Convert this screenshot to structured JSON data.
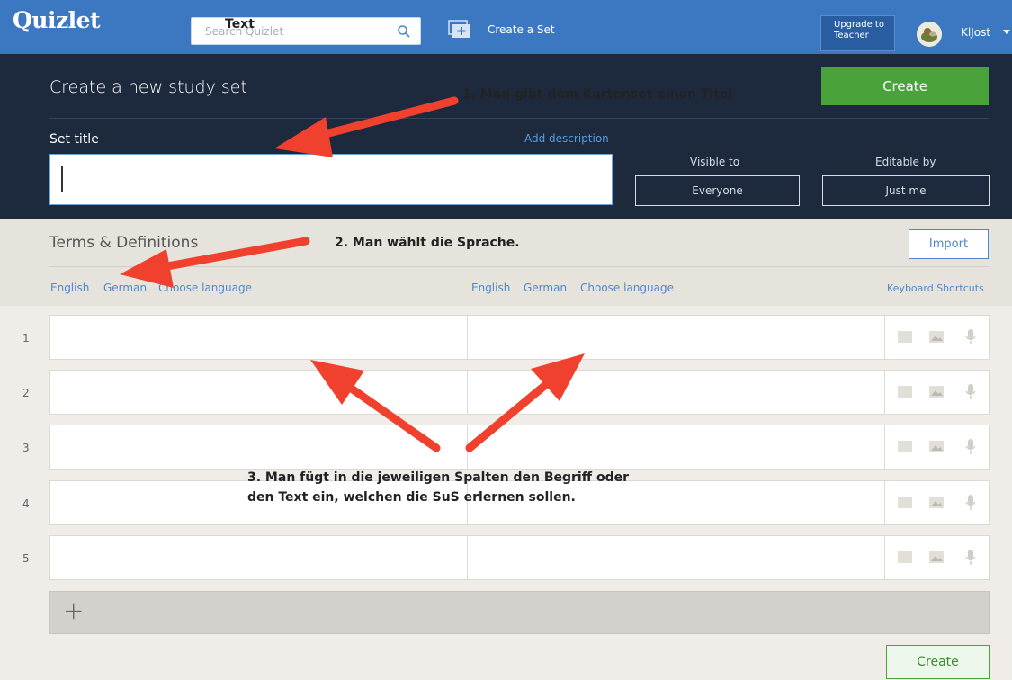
{
  "topbar": {
    "logo": "Quizlet",
    "search_placeholder": "Search Quizlet",
    "search_overlay": "Text",
    "create_set": "Create a Set",
    "upgrade": "Upgrade to Teacher",
    "username": "KlJost"
  },
  "header": {
    "title": "Create a new study set",
    "create_label": "Create",
    "set_title_label": "Set title",
    "add_description": "Add description",
    "visible_label": "Visible to",
    "visible_value": "Everyone",
    "editable_label": "Editable by",
    "editable_value": "Just me"
  },
  "terms": {
    "title": "Terms & Definitions",
    "import_label": "Import",
    "term_lang": [
      "English",
      "German",
      "Choose language"
    ],
    "def_lang": [
      "English",
      "German",
      "Choose language"
    ],
    "keyboard_shortcuts": "Keyboard Shortcuts"
  },
  "cards": [
    {
      "num": "1"
    },
    {
      "num": "2"
    },
    {
      "num": "3"
    },
    {
      "num": "4"
    },
    {
      "num": "5"
    }
  ],
  "add_card_symbol": "+",
  "create_bottom": "Create",
  "annotations": {
    "note1": "1. Man gibt dem Kartenset einen Titel",
    "note2": "2. Man wählt die Sprache.",
    "note3_line1": "3. Man fügt in die jeweiligen Spalten den Begriff oder",
    "note3_line2": "den Text ein, welchen die SuS erlernen sollen.",
    "arrow_color": "#f0412e"
  },
  "colors": {
    "topbar": "#3c78c2",
    "header": "#1d2a3d",
    "create_green": "#4aa23b",
    "link_blue": "#4d88cf"
  },
  "icons": [
    "search-icon",
    "create-set-icon",
    "image-icon",
    "microphone-icon",
    "card-icon",
    "plus-icon",
    "caret-down-icon"
  ]
}
